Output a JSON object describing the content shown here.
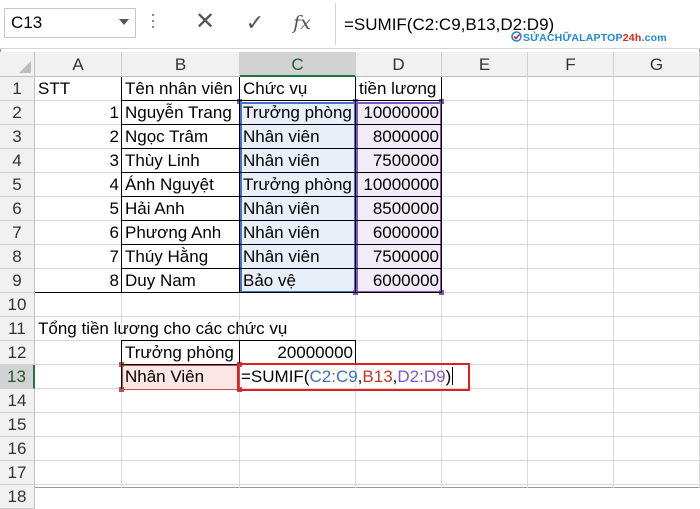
{
  "formula_bar": {
    "name_box": "C13",
    "cancel_glyph": "✕",
    "enter_glyph": "✓",
    "fx_label": "fx",
    "formula": "=SUMIF(C2:C9,B13,D2:D9)"
  },
  "watermark": {
    "part1": "SỬACHỮALAPTOP",
    "part2": "24h",
    "part3": ".com"
  },
  "columns": [
    "A",
    "B",
    "C",
    "D",
    "E",
    "F",
    "G"
  ],
  "rows": [
    "1",
    "2",
    "3",
    "4",
    "5",
    "6",
    "7",
    "8",
    "9",
    "10",
    "11",
    "12",
    "13",
    "14",
    "15",
    "16",
    "17",
    "18"
  ],
  "table": {
    "headers": {
      "stt": "STT",
      "name": "Tên nhân viên",
      "position": "Chức vụ",
      "salary": "tiền lương"
    },
    "records": [
      {
        "stt": "1",
        "name": "Nguyễn Trang",
        "position": "Trưởng phòng",
        "salary": "10000000"
      },
      {
        "stt": "2",
        "name": "Ngọc Trâm",
        "position": "Nhân viên",
        "salary": "8000000"
      },
      {
        "stt": "3",
        "name": "Thùy Linh",
        "position": "Nhân viên",
        "salary": "7500000"
      },
      {
        "stt": "4",
        "name": "Ánh Nguyệt",
        "position": "Trưởng phòng",
        "salary": "10000000"
      },
      {
        "stt": "5",
        "name": "Hải Anh",
        "position": "Nhân viên",
        "salary": "8500000"
      },
      {
        "stt": "6",
        "name": "Phương Anh",
        "position": "Nhân viên",
        "salary": "6000000"
      },
      {
        "stt": "7",
        "name": "Thúy Hằng",
        "position": "Nhân viên",
        "salary": "7500000"
      },
      {
        "stt": "8",
        "name": "Duy Nam",
        "position": "Bảo vệ",
        "salary": "6000000"
      }
    ]
  },
  "summary": {
    "title": "Tổng tiền lương cho các chức vụ",
    "row1_label": "Trưởng phòng",
    "row1_value": "20000000",
    "row2_label": "Nhân Viên",
    "editing_formula": {
      "prefix": "=SUMIF(",
      "arg1": "C2:C9",
      "comma1": ",",
      "arg2": "B13",
      "comma2": ",",
      "arg3": "D2:D9",
      "suffix": ")"
    }
  },
  "colors": {
    "ref1": "#3a6fc2",
    "ref2": "#c0392b",
    "ref3": "#7e57c2",
    "accent": "#217346",
    "highlight_box": "#e02020"
  }
}
